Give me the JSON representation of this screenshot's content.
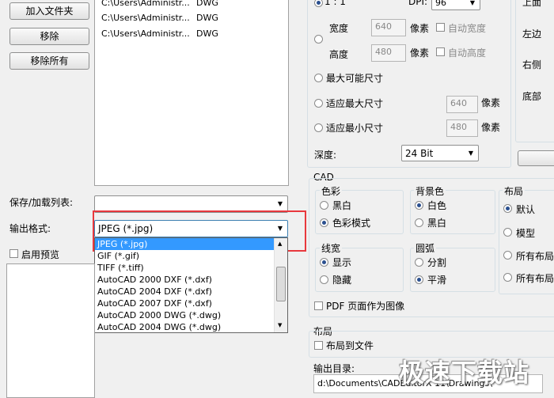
{
  "left_buttons": {
    "add_folder": "加入文件夹",
    "remove": "移除",
    "remove_all": "移除所有"
  },
  "files": [
    {
      "path": "C:\\Users\\Administr...",
      "type": "DWG"
    },
    {
      "path": "C:\\Users\\Administr...",
      "type": "DWG"
    },
    {
      "path": "C:\\Users\\Administr...",
      "type": "DWG"
    }
  ],
  "save_load_list_label": "保存/加载列表:",
  "output_format": {
    "label": "输出格式:",
    "selected": "JPEG (*.jpg)",
    "options": [
      "JPEG (*.jpg)",
      "GIF (*.gif)",
      "TIFF (*.tiff)",
      "AutoCAD 2000 DXF (*.dxf)",
      "AutoCAD 2004 DXF (*.dxf)",
      "AutoCAD 2007 DXF (*.dxf)",
      "AutoCAD 2000 DWG (*.dwg)",
      "AutoCAD 2004 DWG (*.dwg)"
    ]
  },
  "enable_preview": "启用预览",
  "size": {
    "ratio_label": "1 : 1",
    "dpi_label": "DPI:",
    "dpi_value": "96",
    "width_label": "宽度",
    "width_value": "640",
    "height_label": "高度",
    "height_value": "480",
    "px_unit": "像素",
    "auto_width": "自动宽度",
    "auto_height": "自动高度",
    "max_possible": "最大可能尺寸",
    "fit_max": "适应最大尺寸",
    "fit_max_value": "640",
    "fit_min": "适应最小尺寸",
    "fit_min_value": "480",
    "depth_label": "深度:",
    "depth_value": "24 Bit"
  },
  "right_margins": [
    "上面",
    "左边",
    "右侧",
    "底部"
  ],
  "cad": {
    "title": "CAD",
    "color_title": "色彩",
    "color_options": [
      "黑白",
      "色彩模式"
    ],
    "bg_title": "背景色",
    "bg_options": [
      "白色",
      "黑白"
    ],
    "layout_title": "布局",
    "layout_options": [
      "默认",
      "模型",
      "所有布局",
      "所有布局"
    ],
    "lineweight_title": "线宽",
    "lineweight_options": [
      "显示",
      "隐藏"
    ],
    "arc_title": "圆弧",
    "arc_options": [
      "分割",
      "平滑"
    ],
    "pdf_pages_as_image": "PDF 页面作为图像"
  },
  "layout_section": {
    "title": "布局",
    "layout_to_file": "布局到文件"
  },
  "output_dir": {
    "label": "输出目录:",
    "value": "d:\\Documents\\CADEditorX 11\\Drawings\\"
  },
  "watermark": "极速下载站"
}
